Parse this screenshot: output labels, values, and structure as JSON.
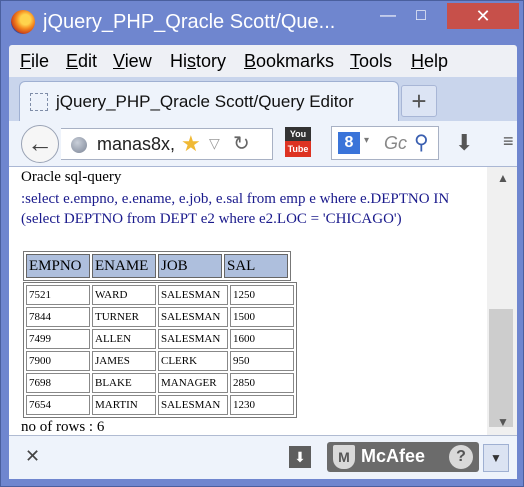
{
  "window": {
    "title": "jQuery_PHP_Qracle Scott/Que...",
    "min_icon": "minimize-icon",
    "max_icon": "maximize-icon",
    "close_icon": "close-icon",
    "min_glyph": "—",
    "max_glyph": "□",
    "close_glyph": "✕",
    "accent": "#6f86cf",
    "close_color": "#c7504a"
  },
  "menu": {
    "items": [
      {
        "u": "F",
        "rest": "ile"
      },
      {
        "u": "E",
        "rest": "dit"
      },
      {
        "u": "V",
        "rest": "iew"
      },
      {
        "pre": "Hi",
        "u": "s",
        "rest": "tory"
      },
      {
        "u": "B",
        "rest": "ookmarks"
      },
      {
        "u": "T",
        "rest": "ools"
      },
      {
        "u": "H",
        "rest": "elp"
      }
    ]
  },
  "tab": {
    "label": "jQuery_PHP_Qracle Scott/Query Editor",
    "new_tab": "+"
  },
  "nav": {
    "back_glyph": "←",
    "url": "manas8x,",
    "star_glyph": "★",
    "drop_glyph": "▽",
    "reload_glyph": "↻",
    "yt_top": "You",
    "yt_bottom": "Tube",
    "search_engine": "8",
    "search_caret": "▾",
    "search_placeholder": "Gc",
    "search_glyph": "⚲",
    "download_glyph": "⬇",
    "more_glyph": "≡"
  },
  "content": {
    "title": "Oracle sql-query",
    "query": ":select e.empno, e.ename, e.job, e.sal from emp e where e.DEPTNO IN (select DEPTNO from DEPT e2 where e2.LOC = 'CHICAGO')",
    "headers": [
      "EMPNO",
      "ENAME",
      "JOB",
      "SAL"
    ],
    "rows": [
      [
        "7521",
        "WARD",
        "SALESMAN",
        "1250"
      ],
      [
        "7844",
        "TURNER",
        "SALESMAN",
        "1500"
      ],
      [
        "7499",
        "ALLEN",
        "SALESMAN",
        "1600"
      ],
      [
        "7900",
        "JAMES",
        "CLERK",
        "950"
      ],
      [
        "7698",
        "BLAKE",
        "MANAGER",
        "2850"
      ],
      [
        "7654",
        "MARTIN",
        "SALESMAN",
        "1230"
      ]
    ],
    "row_count": "no of rows : 6"
  },
  "scrollbar": {
    "up_glyph": "▲",
    "down_glyph": "▼"
  },
  "addon_bar": {
    "close_glyph": "✕",
    "download_glyph": "⬇",
    "mcafee_label": "McAfee",
    "mcafee_shield": "M",
    "help_glyph": "?",
    "arrow_glyph": "▼"
  }
}
